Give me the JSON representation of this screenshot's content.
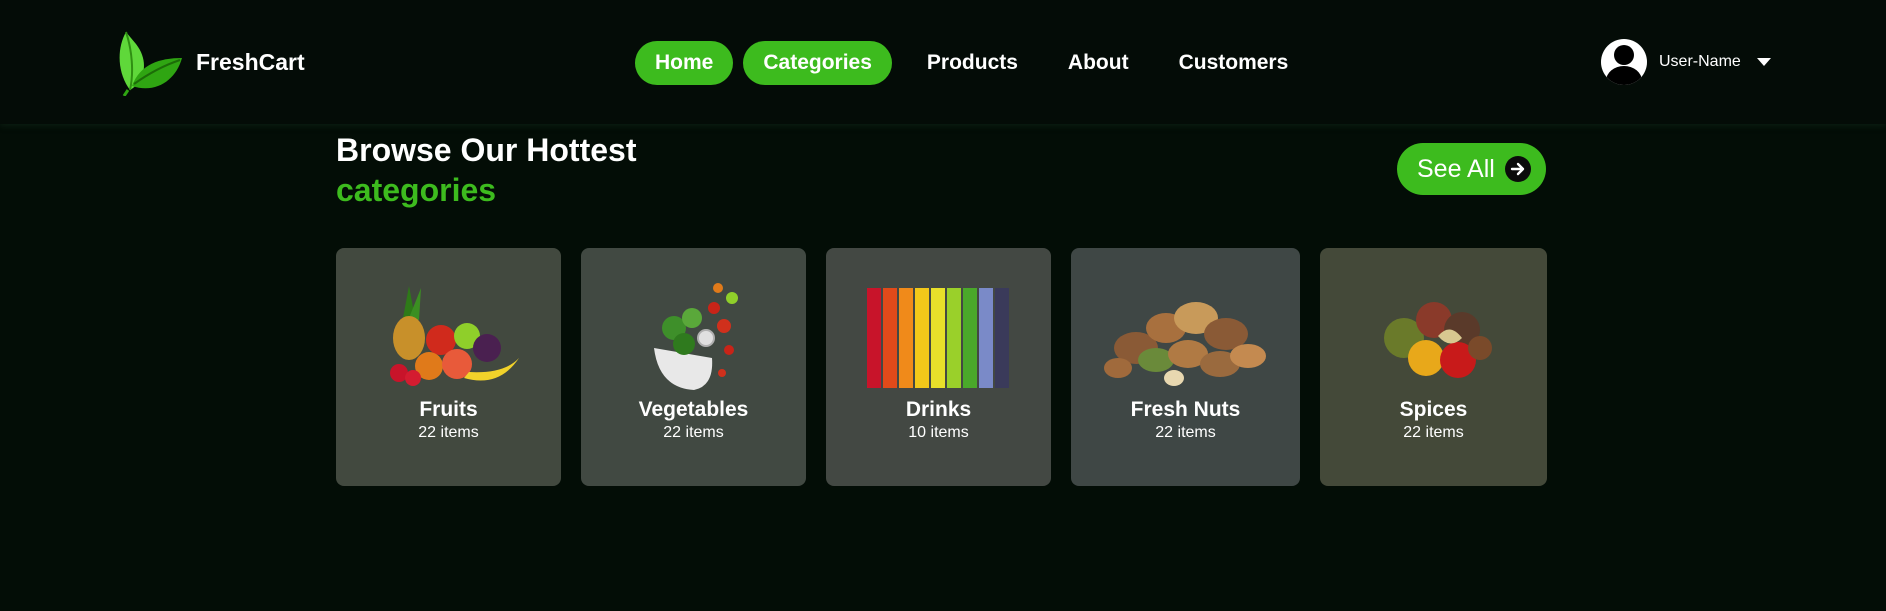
{
  "brand": {
    "name": "FreshCart",
    "accent": "#3dbb1e"
  },
  "nav": {
    "items": [
      {
        "label": "Home",
        "active": true
      },
      {
        "label": "Categories",
        "active": true
      },
      {
        "label": "Products",
        "active": false
      },
      {
        "label": "About",
        "active": false
      },
      {
        "label": "Customers",
        "active": false
      }
    ]
  },
  "user": {
    "name": "User-Name",
    "avatar_icon": "user-avatar-icon",
    "menu_icon": "caret-down-icon"
  },
  "section": {
    "title_line1": "Browse Our Hottest",
    "title_line2": "categories",
    "see_all_label": "See All",
    "see_all_icon": "arrow-right-circle-icon"
  },
  "categories": [
    {
      "name": "Fruits",
      "count": "22 items",
      "bg": "#42493f",
      "image": "fruits-image"
    },
    {
      "name": "Vegetables",
      "count": "22 items",
      "bg": "#414942",
      "image": "vegetables-image"
    },
    {
      "name": "Drinks",
      "count": "10 items",
      "bg": "#434843",
      "image": "drinks-image"
    },
    {
      "name": "Fresh Nuts",
      "count": "22 items",
      "bg": "#3f4745",
      "image": "nuts-image"
    },
    {
      "name": "Spices",
      "count": "22 items",
      "bg": "#444939",
      "image": "spices-image"
    }
  ]
}
